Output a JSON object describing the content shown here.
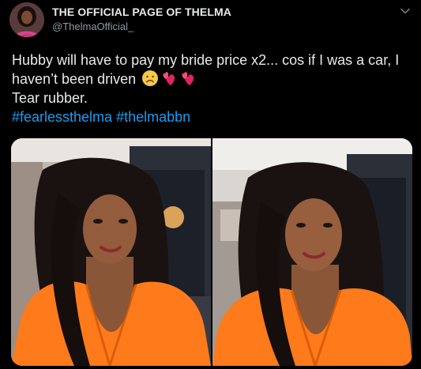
{
  "tweet": {
    "author": {
      "display_name": "THE OFFICIAL PAGE OF THELMA",
      "handle": "@ThelmaOfficial_",
      "avatar_icon": "avatar"
    },
    "menu_icon": "chevron-down-icon",
    "text": {
      "line1": "Hubby will have to pay my bride price x2... cos if I was a car, I haven’t been driven",
      "line2": "Tear rubber.",
      "emojis": [
        "frowning-face-emoji",
        "heart-emoji",
        "heart-emoji"
      ],
      "hashtags": [
        "#fearlessthelma",
        "#thelmabbn"
      ]
    },
    "media": {
      "count": 2
    }
  },
  "colors": {
    "background": "#000000",
    "text": "#e7e9ea",
    "secondary_text": "#8b98a5",
    "link": "#1d9bf0",
    "orange_outfit": "#ff7a1a"
  }
}
